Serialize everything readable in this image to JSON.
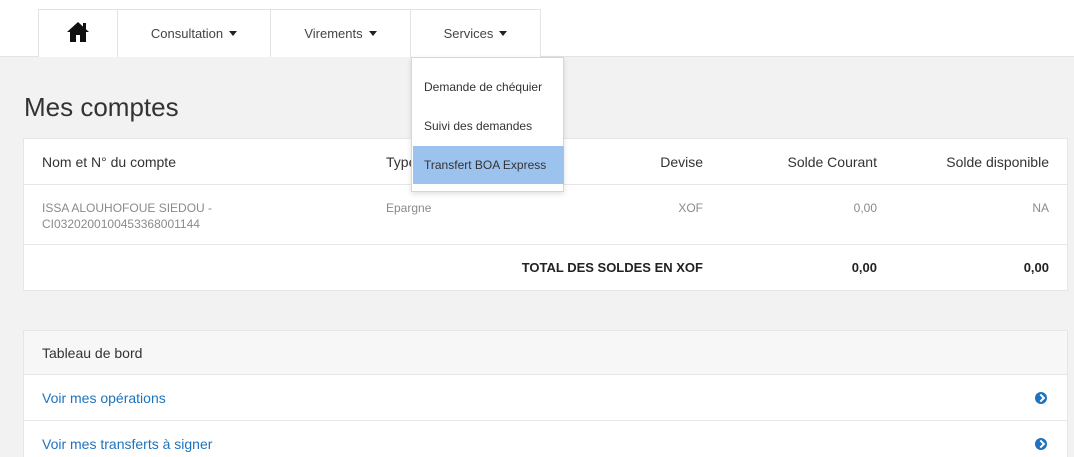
{
  "nav": {
    "consultation": "Consultation",
    "virements": "Virements",
    "services": "Services"
  },
  "services_menu": {
    "items": [
      "Demande de chéquier",
      "Suivi des demandes",
      "Transfert BOA Express"
    ],
    "active_index": 2
  },
  "page": {
    "title": "Mes comptes"
  },
  "accounts": {
    "headers": {
      "name": "Nom et N° du compte",
      "type": "Type",
      "devise": "Devise",
      "solde_courant": "Solde Courant",
      "solde_disponible": "Solde disponible"
    },
    "rows": [
      {
        "name_line1": "ISSA ALOUHOFOUE SIEDOU -",
        "name_line2": "CI0320200100453368001144",
        "type": "Epargne",
        "devise": "XOF",
        "solde_courant": "0,00",
        "solde_disponible": "NA"
      }
    ],
    "total": {
      "label": "TOTAL DES SOLDES EN XOF",
      "solde_courant": "0,00",
      "solde_disponible": "0,00"
    }
  },
  "dashboard": {
    "title": "Tableau de bord",
    "links": [
      "Voir mes opérations",
      "Voir mes transferts à signer"
    ]
  },
  "colors": {
    "link": "#1e73be",
    "menu_active": "#9cc3ee"
  }
}
